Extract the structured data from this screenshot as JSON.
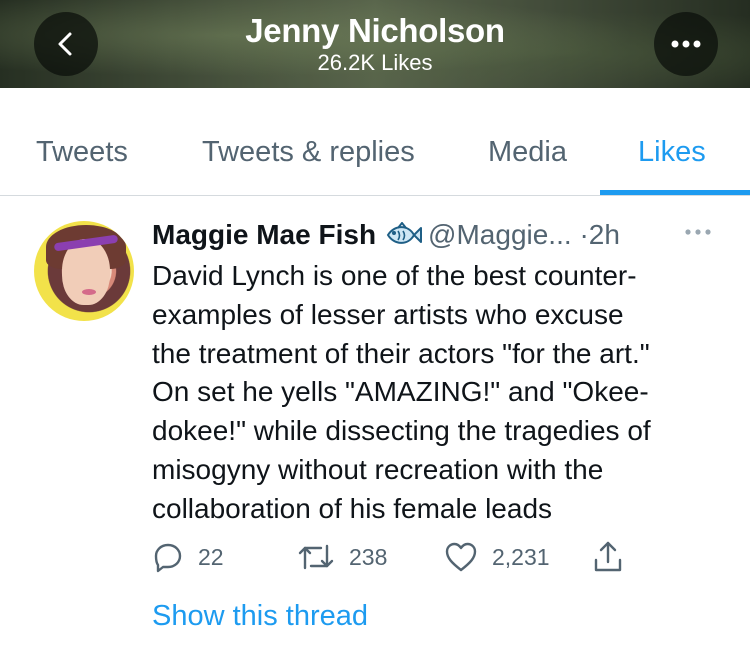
{
  "header": {
    "title": "Jenny Nicholson",
    "subtitle": "26.2K Likes"
  },
  "tabs": [
    {
      "label": "Tweets"
    },
    {
      "label": "Tweets & replies"
    },
    {
      "label": "Media"
    },
    {
      "label": "Likes",
      "active": true
    }
  ],
  "tweet": {
    "author": "Maggie Mae Fish",
    "author_emoji": "fish-icon",
    "handle": "@Maggie...",
    "dot": "·",
    "time": "2h",
    "text_lines": [
      "David Lynch is one of the best counter-",
      "examples of lesser artists who excuse",
      "the treatment of their actors \"for the art.\"",
      "On set he yells \"AMAZING!\" and \"Okee-",
      "dokee!\" while dissecting the tragedies of",
      "misogyny without recreation with the",
      "collaboration of his female leads"
    ],
    "replies": "22",
    "retweets": "238",
    "likes": "2,231",
    "show_thread": "Show this thread"
  },
  "colors": {
    "accent": "#1d9bf0",
    "secondary_text": "#536471",
    "primary_text": "#0f1419"
  }
}
